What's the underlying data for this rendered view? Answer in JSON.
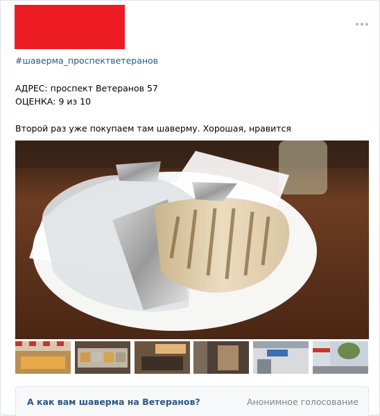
{
  "post": {
    "hashtag": "#шаверма_проспектветеранов",
    "address": "АДРЕС: проспект Ветеранов 57",
    "rating": "ОЦЕНКА: 9 из 10",
    "text": "Второй раз уже покупаем там шаверму. Хорошая, нравится"
  },
  "poll": {
    "question": "А как вам шаверма на Ветеранов?",
    "type": "Анонимное голосование"
  },
  "colors": {
    "link": "#2a5885",
    "redaction": "#ed1c24",
    "muted": "#828282"
  },
  "icons": {
    "more": "more-dots-icon"
  }
}
